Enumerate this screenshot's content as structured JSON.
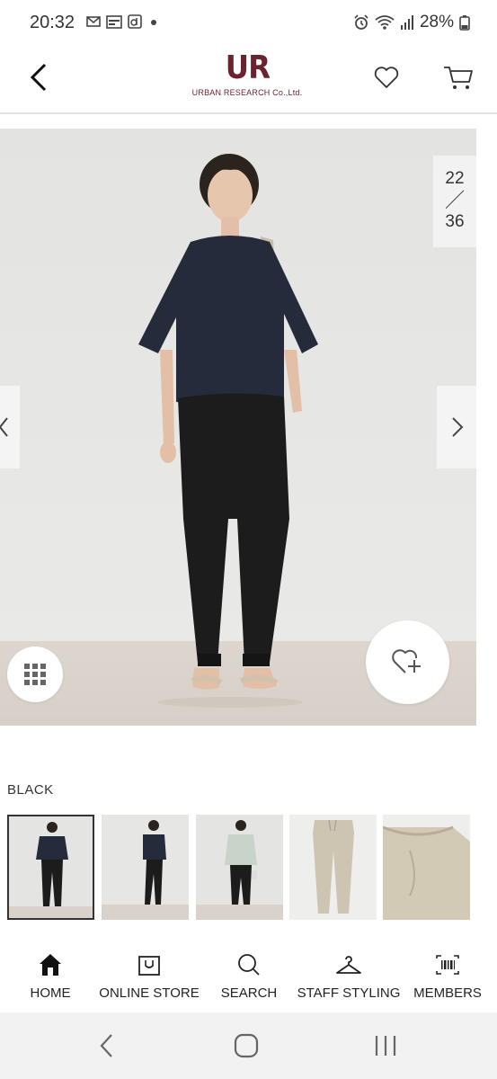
{
  "status_bar": {
    "time": "20:32",
    "battery": "28%"
  },
  "header": {
    "logo_mark": "UR",
    "logo_text": "URBAN RESEARCH Co.,Ltd."
  },
  "gallery": {
    "current": "22",
    "separator": "／",
    "total": "36"
  },
  "product": {
    "color_name": "BLACK",
    "thumbnails": [
      "outfit-navy-front",
      "outfit-navy-side",
      "outfit-mint-blouse",
      "pants-beige-flat",
      "pants-beige-detail"
    ],
    "selected_thumbnail": 0
  },
  "bottom_nav": {
    "items": [
      {
        "label": "HOME",
        "icon": "home-icon"
      },
      {
        "label": "ONLINE STORE",
        "icon": "shopping-bag-icon"
      },
      {
        "label": "SEARCH",
        "icon": "search-icon"
      },
      {
        "label": "STAFF STYLING",
        "icon": "hanger-icon"
      },
      {
        "label": "MEMBERS",
        "icon": "barcode-icon"
      }
    ]
  },
  "colors": {
    "brand": "#6a2330",
    "text": "#222222",
    "divider": "#e2e2e2"
  }
}
